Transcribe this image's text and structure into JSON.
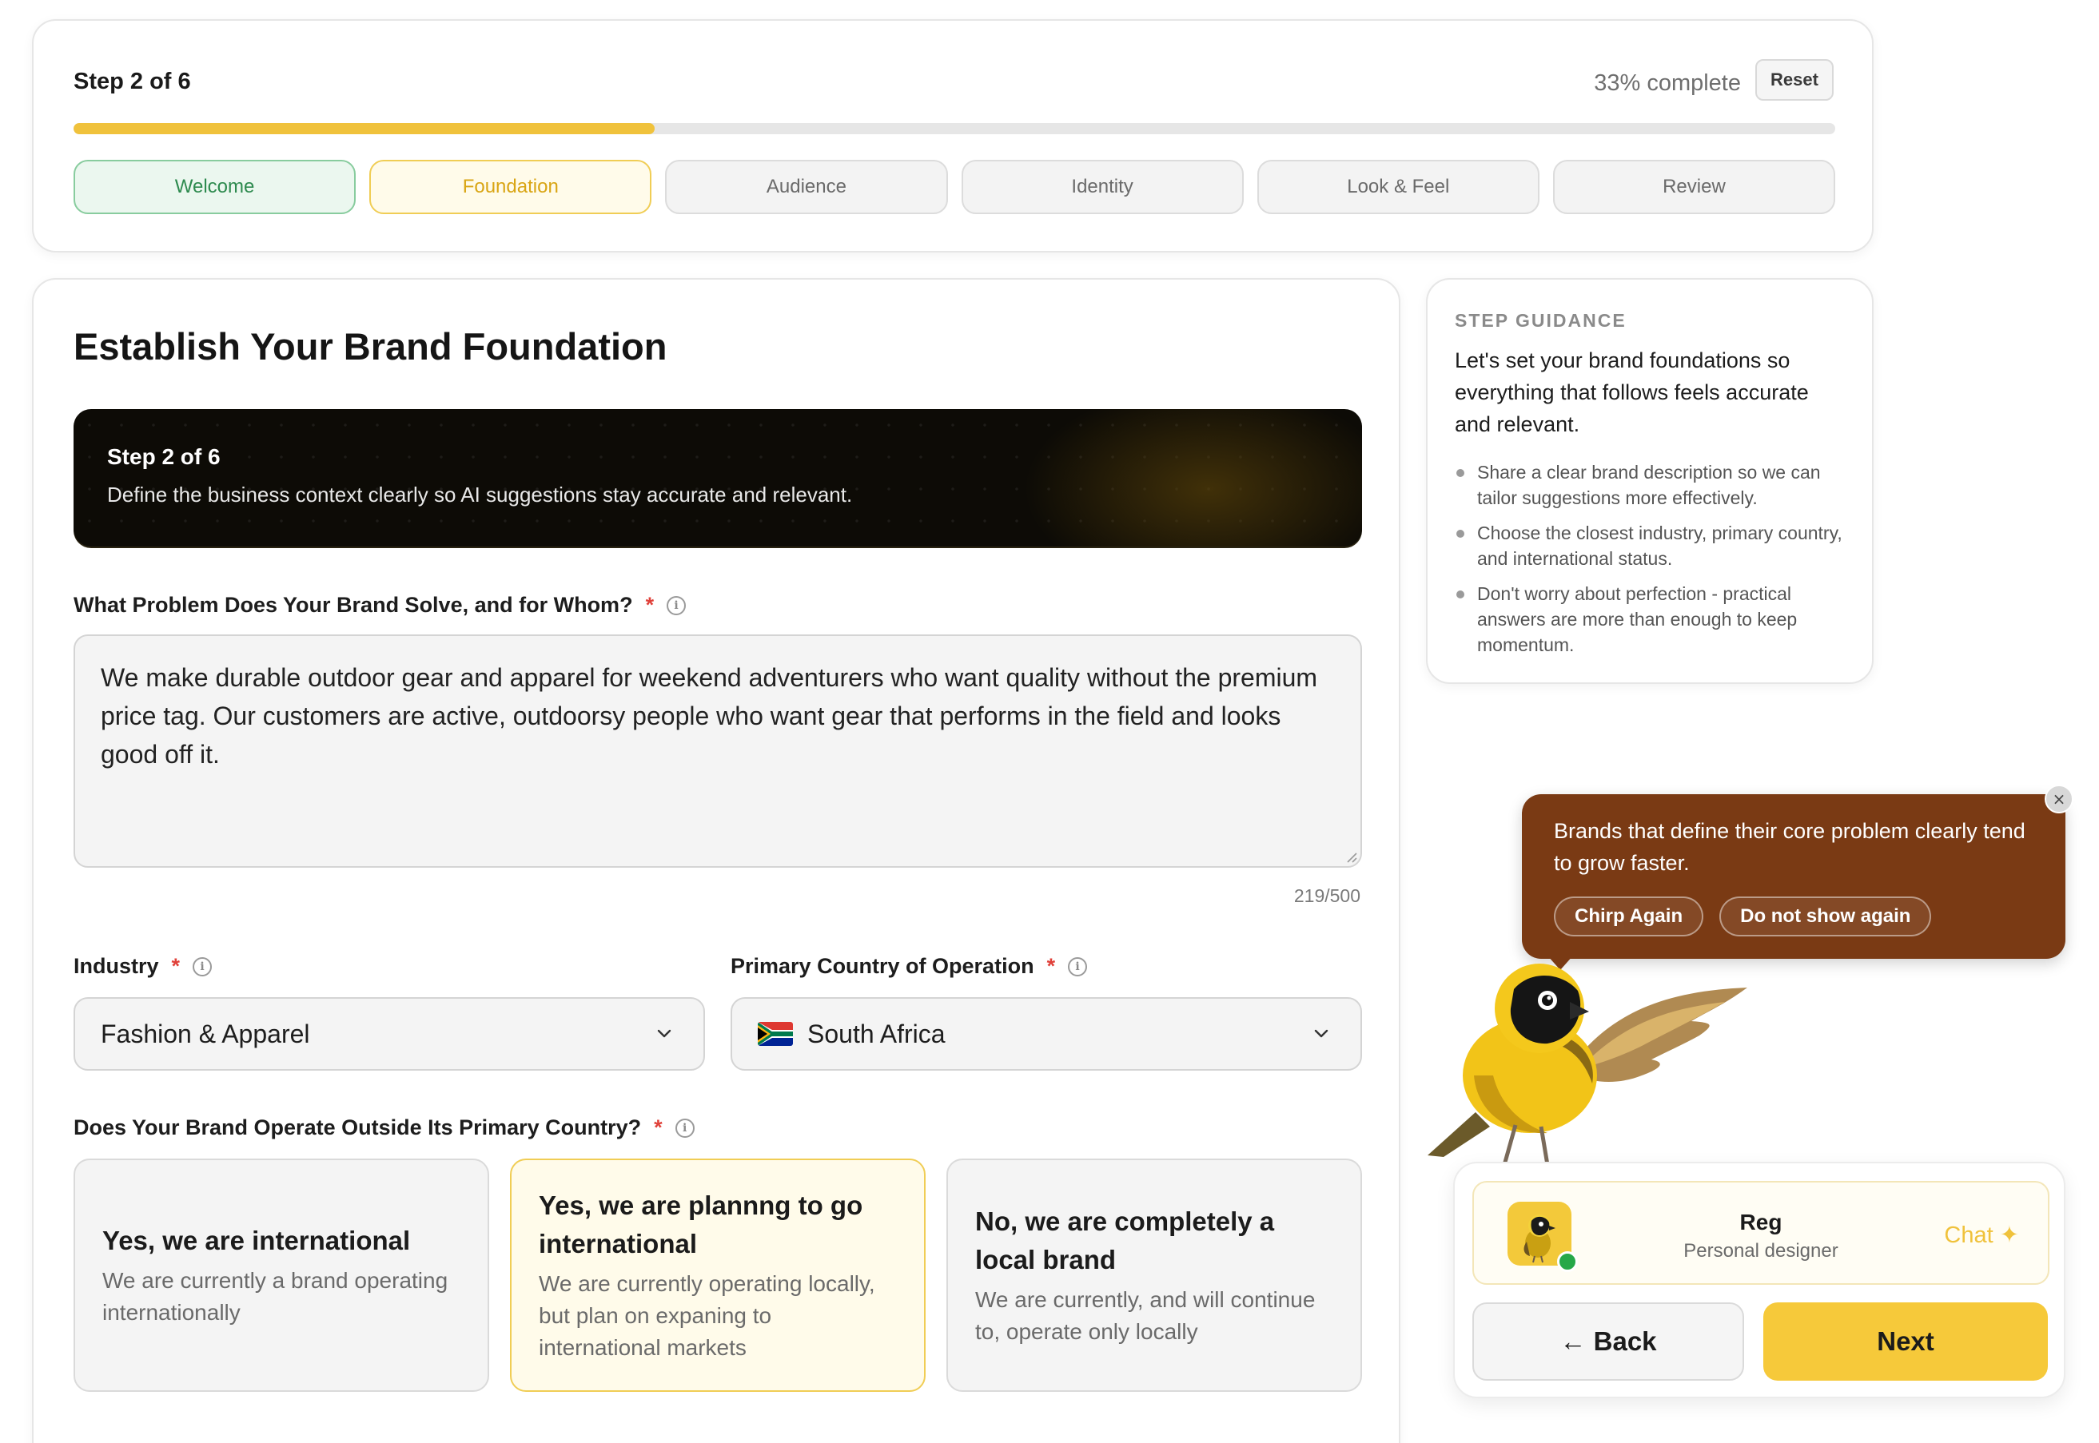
{
  "progress": {
    "step_label": "Step 2 of 6",
    "percent_label": "33% complete",
    "percent_value": 33,
    "reset_label": "Reset",
    "tabs": [
      {
        "label": "Welcome",
        "state": "done"
      },
      {
        "label": "Foundation",
        "state": "active"
      },
      {
        "label": "Audience",
        "state": "pending"
      },
      {
        "label": "Identity",
        "state": "pending"
      },
      {
        "label": "Look & Feel",
        "state": "pending"
      },
      {
        "label": "Review",
        "state": "pending"
      }
    ]
  },
  "main": {
    "title": "Establish Your Brand Foundation",
    "banner": {
      "title": "Step 2 of 6",
      "text": "Define the business context clearly so AI suggestions stay accurate and relevant."
    },
    "problem": {
      "label": "What Problem Does Your Brand Solve, and for Whom?",
      "required_mark": "*",
      "value": "We make durable outdoor gear and apparel for weekend adventurers who want quality without the premium price tag. Our customers are active, outdoorsy people who want gear that performs in the field and looks good off it.",
      "char_count": "219/500"
    },
    "industry": {
      "label": "Industry",
      "required_mark": "*",
      "value": "Fashion & Apparel"
    },
    "country": {
      "label": "Primary Country of Operation",
      "required_mark": "*",
      "value": "South Africa",
      "flag_icon": "south-africa-flag-icon"
    },
    "international": {
      "label": "Does Your Brand Operate Outside Its Primary Country?",
      "required_mark": "*",
      "options": [
        {
          "title": "Yes, we are international",
          "desc": "We are currently a brand operating internationally",
          "selected": false
        },
        {
          "title": "Yes, we are plannng to go international",
          "desc": "We are currently operating locally, but plan on expaning to international markets",
          "selected": true
        },
        {
          "title": "No, we are completely a local brand",
          "desc": "We are currently, and will continue to, operate only locally",
          "selected": false
        }
      ]
    }
  },
  "guidance": {
    "kicker": "STEP GUIDANCE",
    "lead": "Let's set your brand foundations so everything that follows feels accurate and relevant.",
    "items": [
      "Share a clear brand description so we can tailor suggestions more effectively.",
      "Choose the closest industry, primary country, and international status.",
      "Don't worry about perfection - practical answers are more than enough to keep momentum."
    ]
  },
  "tooltip": {
    "text": "Brands that define their core problem clearly tend to grow faster.",
    "chirp_label": "Chirp Again",
    "dismiss_label": "Do not show again",
    "close_glyph": "×"
  },
  "assistant": {
    "name": "Reg",
    "role": "Personal designer",
    "chat_label": "Chat ✦",
    "back_label": "← Back",
    "next_label": "Next"
  },
  "colors": {
    "accent_yellow": "#f0c23c",
    "tooltip_brown": "#7a3a14",
    "done_green": "#2d8a4e",
    "required_red": "#e0413a"
  }
}
